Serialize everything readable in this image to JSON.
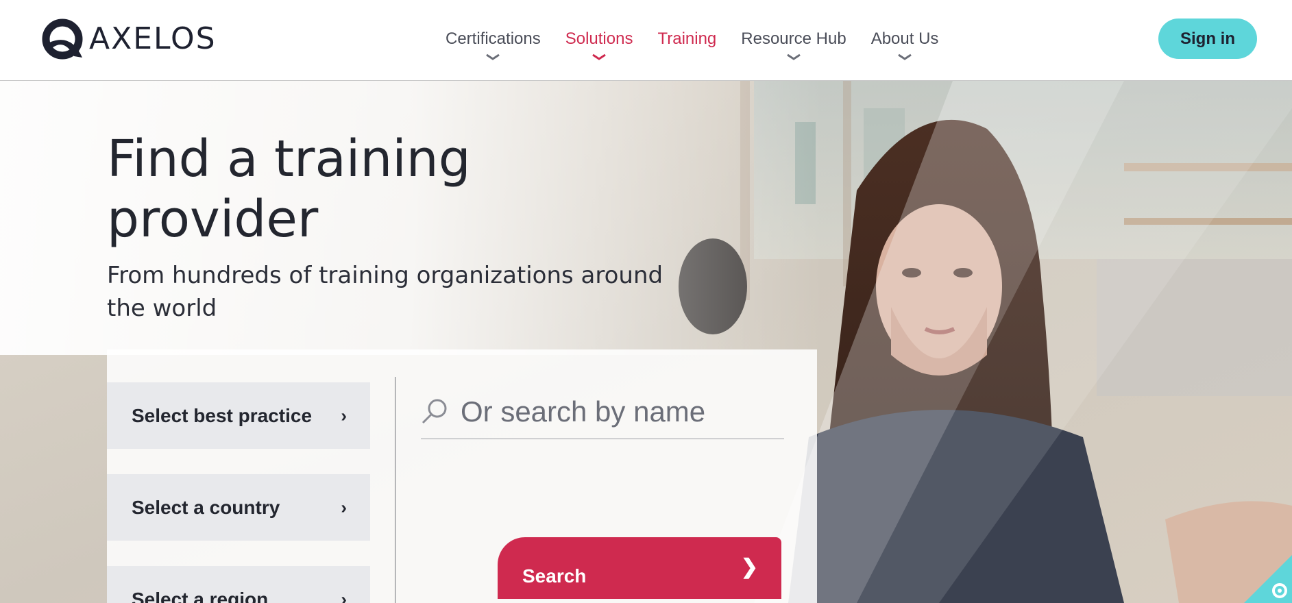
{
  "header": {
    "logo_text": "AXELOS",
    "nav": [
      {
        "label": "Certifications",
        "has_dropdown": true,
        "active": false
      },
      {
        "label": "Solutions",
        "has_dropdown": true,
        "active": true
      },
      {
        "label": "Training",
        "has_dropdown": false,
        "active": true
      },
      {
        "label": "Resource Hub",
        "has_dropdown": true,
        "active": false
      },
      {
        "label": "About Us",
        "has_dropdown": true,
        "active": false
      }
    ],
    "signin_label": "Sign in"
  },
  "hero": {
    "title_line1": "Find a training",
    "title_line2": "provider",
    "subtitle_line1": "From hundreds of training organizations around",
    "subtitle_line2": "the world"
  },
  "filters": {
    "best_practice_label": "Select best practice",
    "country_label": "Select a country",
    "region_label": "Select a region",
    "arrow": "›"
  },
  "search": {
    "placeholder": "Or search by name",
    "button_label": "Search",
    "button_arrow": "❯"
  },
  "colors": {
    "accent_red": "#cf2a4f",
    "signin_teal": "#5ed6da",
    "text_dark": "#23262f"
  },
  "icons": {
    "search": "search-icon",
    "chevron": "chevron-down-icon",
    "cookie": "gear-icon"
  }
}
